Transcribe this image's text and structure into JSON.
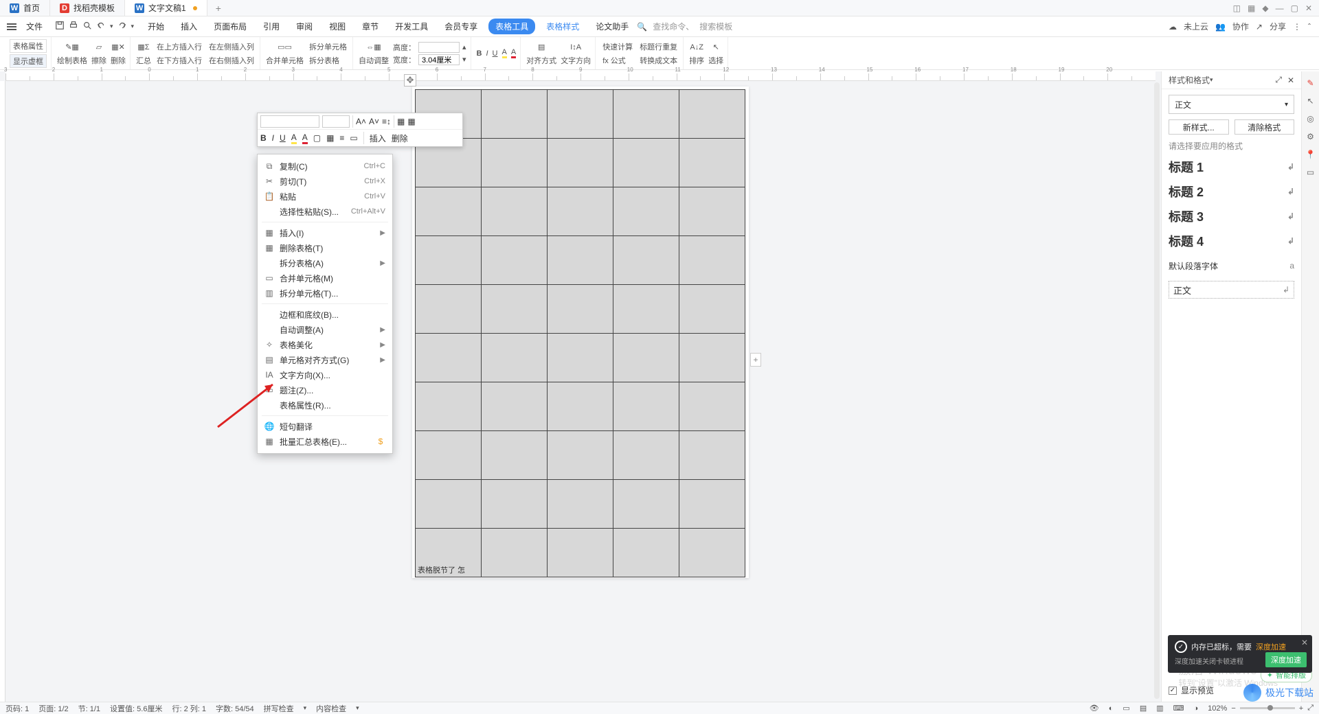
{
  "tabs": [
    {
      "label": "首页",
      "icon": "W",
      "icon_class": "logo-blue"
    },
    {
      "label": "找稻壳模板",
      "icon": "D",
      "icon_class": "logo-red"
    },
    {
      "label": "文字文稿1",
      "icon": "W",
      "icon_class": "logo-blue",
      "dirty": true
    }
  ],
  "menu": "文件",
  "ribbon_tabs": [
    "开始",
    "插入",
    "页面布局",
    "引用",
    "审阅",
    "视图",
    "章节",
    "开发工具",
    "会员专享",
    "表格工具",
    "表格样式",
    "论文助手"
  ],
  "ribbon_active": "表格工具",
  "ribbon_after_active": "表格样式",
  "search": {
    "placeholder1": "查找命令、",
    "placeholder2": "搜索模板"
  },
  "cloud": {
    "not_uploaded": "未上云",
    "collab": "协作",
    "share": "分享"
  },
  "ribbon": {
    "table_props": "表格属性",
    "show_grid": "显示虚框",
    "draw": "绘制表格",
    "erase": "擦除",
    "delete": "删除",
    "summary": "汇总",
    "ins_above": "在上方插入行",
    "ins_below": "在下方插入行",
    "ins_left": "在左侧插入列",
    "ins_right": "在右侧插入列",
    "merge": "合并单元格",
    "split_cell": "拆分单元格",
    "split_tbl": "拆分表格",
    "auto_adjust": "自动调整",
    "height": "高度：",
    "width": "宽度：",
    "width_val": "3.04厘米",
    "align": "对齐方式",
    "text_dir": "文字方向",
    "quick_calc": "快速计算",
    "repeat_header": "标题行重复",
    "formula": "fx 公式",
    "to_text": "转换成文本",
    "sort": "排序",
    "select": "选择"
  },
  "mini_tb": {
    "insert": "插入",
    "delete": "删除"
  },
  "ctx": {
    "copy": "复制(C)",
    "copy_sc": "Ctrl+C",
    "cut": "剪切(T)",
    "cut_sc": "Ctrl+X",
    "paste": "粘贴",
    "paste_sc": "Ctrl+V",
    "paste_special": "选择性粘贴(S)...",
    "paste_special_sc": "Ctrl+Alt+V",
    "insert": "插入(I)",
    "del_tbl": "删除表格(T)",
    "split_tbl": "拆分表格(A)",
    "merge": "合并单元格(M)",
    "split_cell": "拆分单元格(T)...",
    "border": "边框和底纹(B)...",
    "auto": "自动调整(A)",
    "beautify": "表格美化",
    "cell_align": "单元格对齐方式(G)",
    "text_dir": "文字方向(X)...",
    "caption": "题注(Z)...",
    "tbl_props": "表格属性(R)...",
    "translate": "短句翻译",
    "batch": "批量汇总表格(E)..."
  },
  "page_caption": "表格脱节了 怎",
  "panel": {
    "title": "样式和格式",
    "current": "正文",
    "new": "新样式...",
    "clear": "清除格式",
    "hint": "请选择要应用的格式",
    "styles": [
      "标题 1",
      "标题 2",
      "标题 3",
      "标题 4"
    ],
    "default_para": "默认段落字体",
    "body": "正文",
    "show_preview": "显示预览"
  },
  "wm": {
    "l1": "激活 Windows",
    "l2": "转到\"设置\"以激活 Windows"
  },
  "toast": {
    "title_a": "内存已超标，需要",
    "title_b": "深度加速",
    "sub": "深度加速关闭卡顿进程",
    "btn": "深度加速"
  },
  "ai_pill": "智能排版",
  "brand": "极光下载站",
  "status": {
    "page_no": "页码: 1",
    "page": "页面: 1/2",
    "sec": "节: 1/1",
    "set": "设置值: 5.6厘米",
    "rc": "行: 2  列: 1",
    "wc": "字数: 54/54",
    "spell": "拼写检查",
    "content": "内容检查",
    "zoom": "102%"
  }
}
